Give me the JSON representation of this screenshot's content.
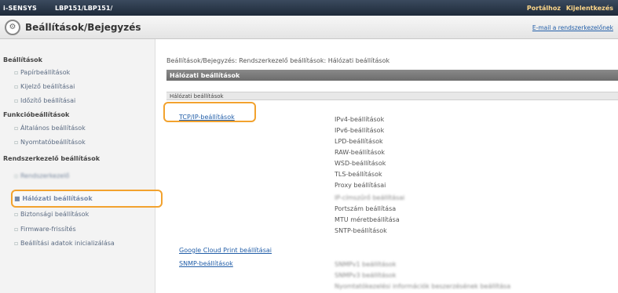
{
  "topbar": {
    "brand": "i-SENSYS",
    "model": "LBP151/LBP151/",
    "links": [
      "Portálhoz",
      "Kijelentkezés"
    ]
  },
  "header": {
    "title": "Beállítások/Bejegyzés",
    "mail_link": "E-mail a rendszerkezelőnek"
  },
  "sidebar": {
    "sections": [
      {
        "label": "Beállítások",
        "items": [
          {
            "label": "Papírbeállítások"
          },
          {
            "label": "Kijelző beállításai"
          },
          {
            "label": "Időzítő beállításai"
          }
        ]
      },
      {
        "label": "Funkcióbeállítások",
        "items": [
          {
            "label": "Általános beállítások"
          },
          {
            "label": "Nyomtatóbeállítások"
          }
        ]
      },
      {
        "label": "Rendszerkezelő beállítások",
        "items": [
          {
            "label": "Rendszerkezelő",
            "blurred": true
          },
          {
            "label": "Hálózati beállítások",
            "active": true
          },
          {
            "label": "Biztonsági beállítások"
          },
          {
            "label": "Firmware-frissítés"
          },
          {
            "label": "Beállítási adatok inicializálása"
          }
        ]
      }
    ]
  },
  "main": {
    "breadcrumb": "Beállítások/Bejegyzés: Rendszerkezelő beállítások: Hálózati beállítások",
    "section_title": "Hálózati beállítások",
    "sub_title": "Hálózati beállítások",
    "left_links": [
      "TCP/IP-beállítások",
      "Google Cloud Print beállításai",
      "SNMP-beállítások"
    ],
    "right_items": [
      {
        "label": "IPv4-beállítások"
      },
      {
        "label": "IPv6-beállítások"
      },
      {
        "label": "LPD-beállítások"
      },
      {
        "label": "RAW-beállítások"
      },
      {
        "label": "WSD-beállítások"
      },
      {
        "label": "TLS-beállítások"
      },
      {
        "label": "Proxy beállításai"
      },
      {
        "label": "IP-címszűrő beállításai",
        "blurred": true
      },
      {
        "label": "Portszám beállítása"
      },
      {
        "label": "MTU méretbeállítása"
      },
      {
        "label": "SNTP-beállítások"
      },
      {
        "label": "SNMPv1 beállítások",
        "blurred": true
      },
      {
        "label": "SNMPv3 beállítások",
        "blurred": true
      },
      {
        "label": "Nyomtatókezelési információk beszerzésének beállítása",
        "blurred": true
      }
    ]
  }
}
